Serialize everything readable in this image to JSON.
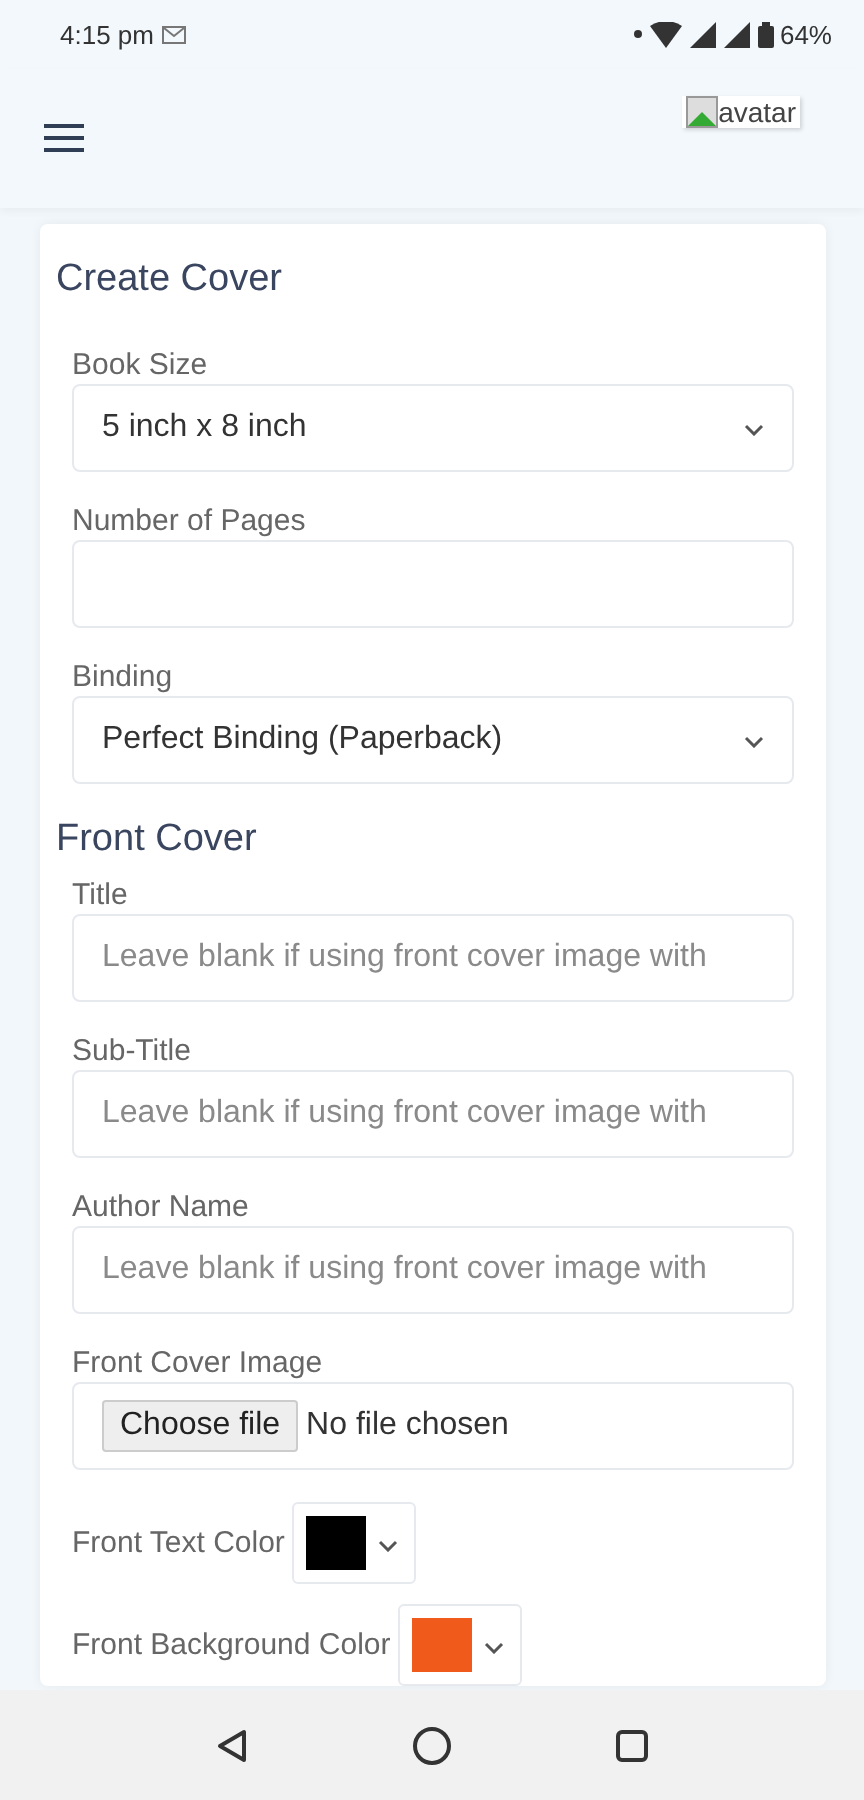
{
  "status_bar": {
    "time": "4:15 pm",
    "battery": "64%"
  },
  "header": {
    "avatar_alt": "avatar"
  },
  "form": {
    "title": "Create Cover",
    "items": [
      {
        "kind": "select",
        "label": "Book Size",
        "value": "5 inch x 8 inch"
      },
      {
        "kind": "text",
        "label": "Number of Pages"
      },
      {
        "kind": "select",
        "label": "Binding",
        "value": "Perfect Binding (Paperback)"
      },
      {
        "kind": "heading",
        "label": "Front Cover"
      },
      {
        "kind": "text",
        "label": "Title",
        "placeholder": "Leave blank if using front cover image with"
      },
      {
        "kind": "text",
        "label": "Sub-Title",
        "placeholder": "Leave blank if using front cover image with"
      },
      {
        "kind": "text",
        "label": "Author Name",
        "placeholder": "Leave blank if using front cover image with"
      },
      {
        "kind": "file",
        "label": "Front Cover Image",
        "button": "Choose file",
        "value": "No file chosen"
      },
      {
        "kind": "color",
        "label": "Front Text Color",
        "color": "#000000"
      },
      {
        "kind": "color",
        "label": "Front Background Color",
        "color": "#f05a1a"
      }
    ]
  }
}
